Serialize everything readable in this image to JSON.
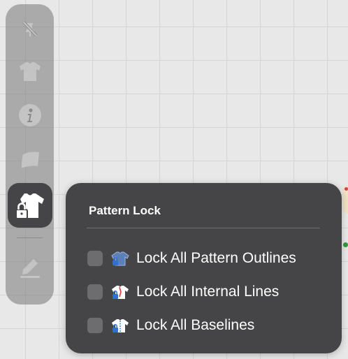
{
  "toolbar": {
    "items": [
      {
        "icon": "unpin-icon"
      },
      {
        "icon": "garment-icon"
      },
      {
        "icon": "info-icon"
      },
      {
        "icon": "fabric-icon"
      },
      {
        "icon": "pattern-lock-icon",
        "active": true
      },
      {
        "icon": "edit-icon"
      }
    ]
  },
  "popup": {
    "title": "Pattern Lock",
    "options": [
      {
        "label": "Lock All Pattern Outlines",
        "checked": false,
        "icon": "outline-lock-icon"
      },
      {
        "label": "Lock All Internal Lines",
        "checked": false,
        "icon": "internal-lines-lock-icon"
      },
      {
        "label": "Lock All Baselines",
        "checked": false,
        "icon": "baseline-lock-icon"
      }
    ]
  },
  "colors": {
    "toolbar_bg": "#767676",
    "popup_bg": "#454547",
    "icon_default": "#bdbdbd",
    "icon_active": "#ffffff",
    "lock_blue": "#2f6fd6"
  }
}
